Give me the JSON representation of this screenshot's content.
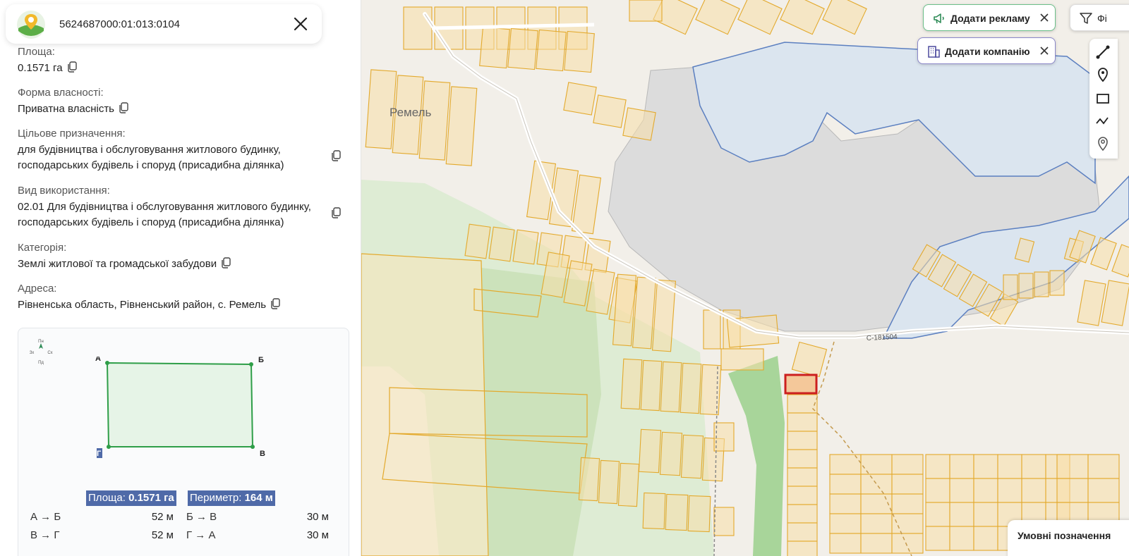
{
  "search": {
    "value": "5624687000:01:013:0104",
    "placeholder": ""
  },
  "details": {
    "area_label": "Площа:",
    "area_value": "0.1571 га",
    "ownership_label": "Форма власності:",
    "ownership_value": "Приватна власність",
    "purpose_label": "Цільове призначення:",
    "purpose_line1": "для будівництва і обслуговування житлового будинку,",
    "purpose_line2": "господарських будівель і споруд (присадибна ділянка)",
    "usage_label": "Вид використання:",
    "usage_line1": "02.01 Для будівництва і обслуговування житлового будинку,",
    "usage_line2": "господарських будівель і споруд (присадибна ділянка)",
    "category_label": "Категорія:",
    "category_value": "Землі житлової та громадської забудови",
    "address_label": "Адреса:",
    "address_value": "Рівненська область, Рівненський район, с. Ремель"
  },
  "plot": {
    "compass": {
      "north": "Пн",
      "south": "Пд",
      "west": "Зх",
      "east": "Сх"
    },
    "vertices": {
      "a": "А",
      "b": "Б",
      "c": "В",
      "d": "Г"
    },
    "area_label": "Площа:",
    "area_value": "0.1571 га",
    "perimeter_label": "Периметр:",
    "perimeter_value": "164 м",
    "sides": [
      {
        "label": "А → Б",
        "value": "52 м"
      },
      {
        "label": "Б → В",
        "value": "30 м"
      },
      {
        "label": "В → Г",
        "value": "52 м"
      },
      {
        "label": "Г → А",
        "value": "30 м"
      }
    ]
  },
  "map": {
    "village_label": "Ремель",
    "road_label": "С-181504",
    "add_ad_label": "Додати рекламу",
    "add_company_label": "Додати компанію",
    "filter_label": "Фі",
    "legend_label": "Умовні позначення",
    "colors": {
      "parcel_stroke": "#e3a92c",
      "parcel_fill": "#f8dfa8",
      "water": "#dfe6ee",
      "forest": "#a8d59a",
      "selected": "#cc1f1f"
    }
  }
}
